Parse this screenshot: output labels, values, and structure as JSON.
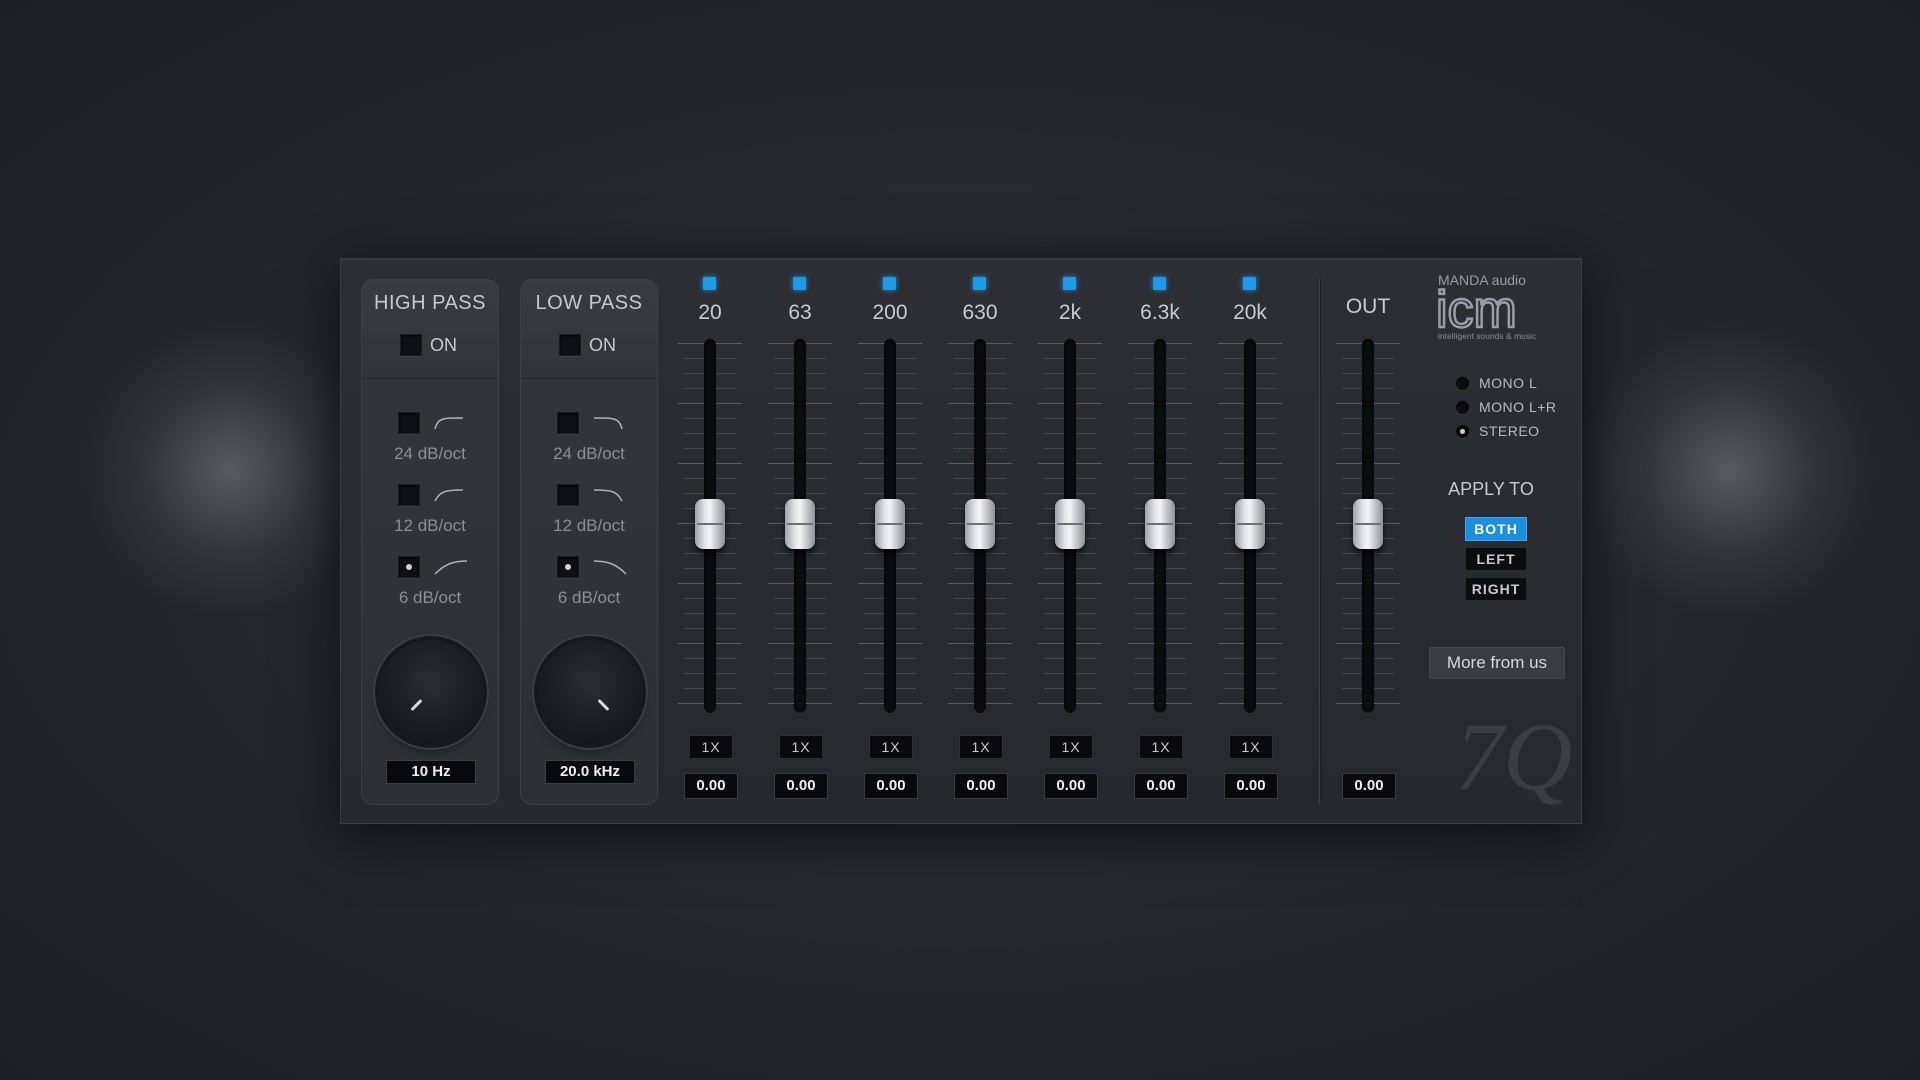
{
  "high_pass": {
    "title": "HIGH PASS",
    "on_label": "ON",
    "slopes": [
      {
        "label": "24 dB/oct",
        "selected": false
      },
      {
        "label": "12 dB/oct",
        "selected": false
      },
      {
        "label": "6 dB/oct",
        "selected": true
      }
    ],
    "value": "10 Hz"
  },
  "low_pass": {
    "title": "LOW PASS",
    "on_label": "ON",
    "slopes": [
      {
        "label": "24 dB/oct",
        "selected": false
      },
      {
        "label": "12 dB/oct",
        "selected": false
      },
      {
        "label": "6 dB/oct",
        "selected": true
      }
    ],
    "value": "20.0 kHz"
  },
  "bands": [
    {
      "freq": "20",
      "q": "1X",
      "gain": "0.00"
    },
    {
      "freq": "63",
      "q": "1X",
      "gain": "0.00"
    },
    {
      "freq": "200",
      "q": "1X",
      "gain": "0.00"
    },
    {
      "freq": "630",
      "q": "1X",
      "gain": "0.00"
    },
    {
      "freq": "2k",
      "q": "1X",
      "gain": "0.00"
    },
    {
      "freq": "6.3k",
      "q": "1X",
      "gain": "0.00"
    },
    {
      "freq": "20k",
      "q": "1X",
      "gain": "0.00"
    }
  ],
  "output": {
    "label": "OUT",
    "gain": "0.00"
  },
  "logo": {
    "brand": "MANDA audio",
    "name": "icm",
    "tagline": "intelligent sounds & music"
  },
  "channel_modes": [
    {
      "label": "MONO L",
      "selected": false
    },
    {
      "label": "MONO L+R",
      "selected": false
    },
    {
      "label": "STEREO",
      "selected": true
    }
  ],
  "apply_to": {
    "title": "APPLY TO",
    "options": [
      {
        "label": "BOTH",
        "active": true
      },
      {
        "label": "LEFT",
        "active": false
      },
      {
        "label": "RIGHT",
        "active": false
      }
    ]
  },
  "more_button": "More from us",
  "product_mark": "7Q",
  "colors": {
    "accent": "#1a8fe0",
    "led": "#1e9be8",
    "panel": "#2a2c31"
  }
}
